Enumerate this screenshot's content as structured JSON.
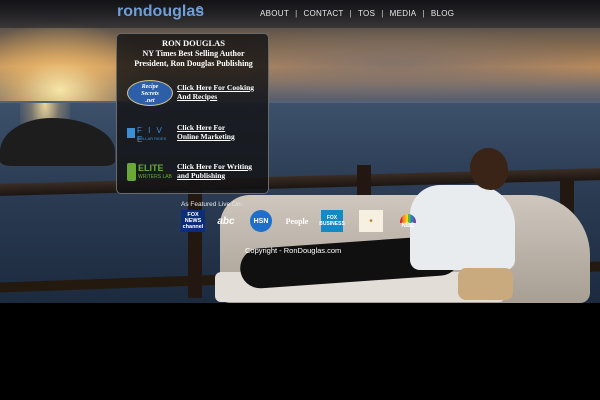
{
  "header": {
    "logo_text": "rondouglas",
    "nav": [
      "ABOUT",
      "CONTACT",
      "TOS",
      "MEDIA",
      "BLOG"
    ],
    "nav_separator": "|"
  },
  "panel": {
    "name": "RON DOUGLAS",
    "subtitle": "NY Times Best Selling Author",
    "subtitle2": "President, Ron Douglas Publishing",
    "items": [
      {
        "badge_text": "Recipe Secrets .net",
        "badge_line1": "Recipe",
        "badge_line2": "Secrets",
        "badge_line3": ".net",
        "link_line1": "Click Here For Cooking",
        "link_line2": "And Recipes"
      },
      {
        "badge_text": "FIVE DOLLAR RIDES",
        "badge_line1": "F I V E",
        "badge_line2": "DOLLAR RIDES",
        "link_line1": "Click Here For",
        "link_line2": "Online Marketing"
      },
      {
        "badge_text": "ELITE WRITERS LAB",
        "badge_line1": "ELITE",
        "badge_line2": "WRITERS LAB",
        "link_line1": "Click Here For Writing",
        "link_line2": "and Publishing"
      }
    ]
  },
  "featured": {
    "label": "As Featured Live On:",
    "logos": [
      {
        "name": "fox-news",
        "line1": "FOX",
        "line2": "NEWS",
        "line3": "channel"
      },
      {
        "name": "abc",
        "text": "abc"
      },
      {
        "name": "hsn",
        "text": "HSN"
      },
      {
        "name": "people",
        "text": "People"
      },
      {
        "name": "fox-business",
        "line1": "FOX",
        "line2": "BUSINESS"
      },
      {
        "name": "hot-topic",
        "text": "★"
      },
      {
        "name": "nbc",
        "text": "NBC"
      }
    ]
  },
  "footer": {
    "copyright": "Copyright - RonDouglas.com"
  },
  "colors": {
    "logo": "#6f9fd8",
    "panel_bg": "#121214",
    "link": "#ffffff",
    "background": "#000000"
  }
}
